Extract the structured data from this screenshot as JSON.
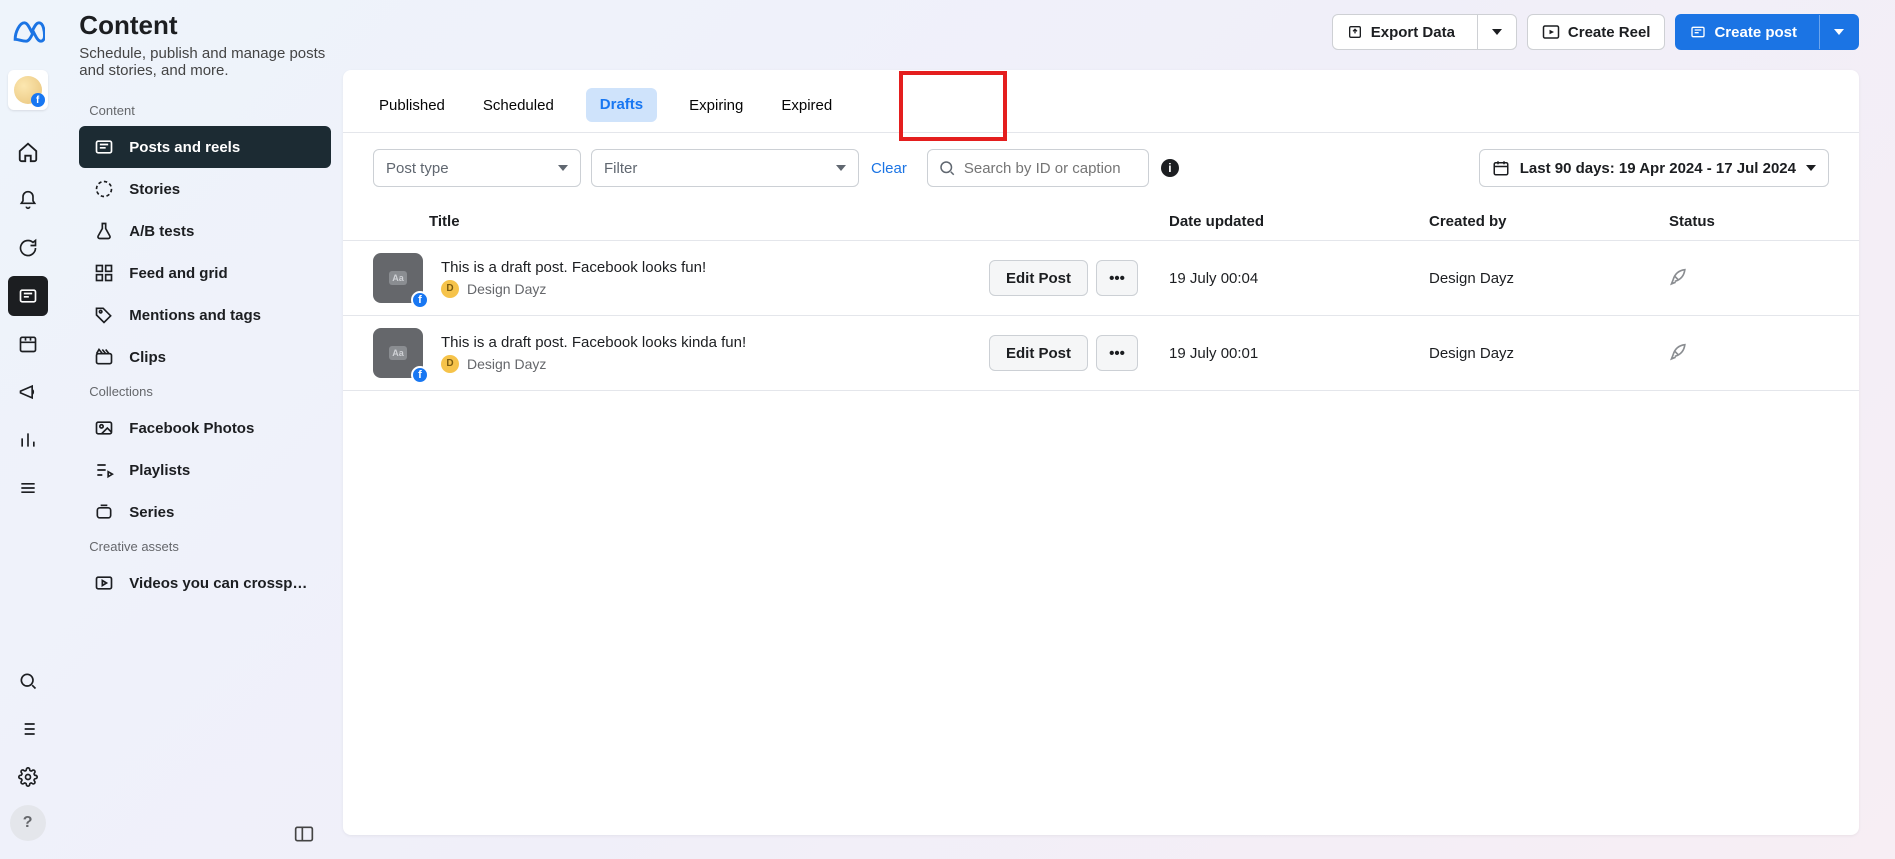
{
  "header": {
    "title": "Content",
    "subtitle": "Schedule, publish and manage posts and stories, and more."
  },
  "actions": {
    "export": "Export Data",
    "create_reel": "Create Reel",
    "create_post": "Create post"
  },
  "sidebar": {
    "sections": {
      "content": "Content",
      "collections": "Collections",
      "creative": "Creative assets"
    },
    "content_items": [
      {
        "label": "Posts and reels",
        "active": true
      },
      {
        "label": "Stories"
      },
      {
        "label": "A/B tests"
      },
      {
        "label": "Feed and grid"
      },
      {
        "label": "Mentions and tags"
      },
      {
        "label": "Clips"
      }
    ],
    "collections_items": [
      {
        "label": "Facebook Photos"
      },
      {
        "label": "Playlists"
      },
      {
        "label": "Series"
      }
    ],
    "creative_items": [
      {
        "label": "Videos you can crossp…"
      }
    ]
  },
  "tabs": [
    {
      "label": "Published"
    },
    {
      "label": "Scheduled"
    },
    {
      "label": "Drafts",
      "active": true
    },
    {
      "label": "Expiring"
    },
    {
      "label": "Expired"
    }
  ],
  "toolbar": {
    "post_type": "Post type",
    "filter": "Filter",
    "clear": "Clear",
    "search_placeholder": "Search by ID or caption",
    "date_range": "Last 90 days: 19 Apr 2024 - 17 Jul 2024"
  },
  "table": {
    "headers": {
      "title": "Title",
      "date": "Date updated",
      "creator": "Created by",
      "status": "Status"
    },
    "rows": [
      {
        "title": "This is a draft post. Facebook looks fun!",
        "author": "Design Dayz",
        "edit": "Edit Post",
        "date": "19 July 00:04",
        "creator": "Design Dayz"
      },
      {
        "title": "This is a draft post. Facebook looks kinda fun!",
        "author": "Design Dayz",
        "edit": "Edit Post",
        "date": "19 July 00:01",
        "creator": "Design Dayz"
      }
    ]
  },
  "rail_help": "?"
}
